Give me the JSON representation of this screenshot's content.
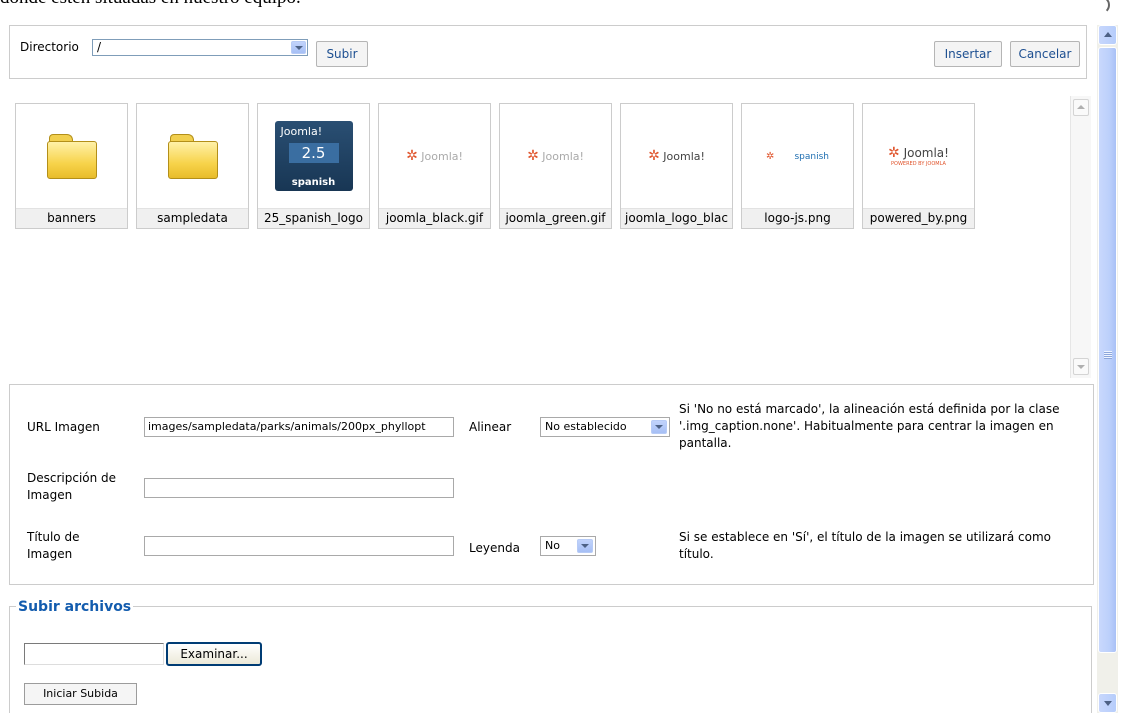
{
  "page": {
    "top_text": "donde estén situadas en nuestro equipo."
  },
  "toolbar": {
    "directory_label": "Directorio",
    "directory_value": "/",
    "up_button": "Subir",
    "insert_button": "Insertar",
    "cancel_button": "Cancelar"
  },
  "browser": {
    "items": [
      {
        "label": "banners",
        "type": "folder"
      },
      {
        "label": "sampledata",
        "type": "folder"
      },
      {
        "label": "25_spanish_logo",
        "type": "image",
        "logo_text": [
          "Joomla!",
          "2.5",
          "spanish"
        ]
      },
      {
        "label": "joomla_black.gif",
        "type": "image",
        "logo_text": "Joomla!"
      },
      {
        "label": "joomla_green.gif",
        "type": "image",
        "logo_text": "Joomla!"
      },
      {
        "label": "joomla_logo_blac",
        "type": "image",
        "logo_text": "Joomla!"
      },
      {
        "label": "logo-js.png",
        "type": "image",
        "logo_text": "spanish"
      },
      {
        "label": "powered_by.png",
        "type": "image",
        "logo_text": [
          "Joomla!",
          "POWERED BY JOOMLA"
        ]
      }
    ]
  },
  "details": {
    "url_label": "URL Imagen",
    "url_value": "images/sampledata/parks/animals/200px_phyllopt",
    "align_label": "Alinear",
    "align_value": "No establecido",
    "align_note": "Si 'No no está marcado', la alineación está definida por la clase '.img_caption.none'. Habitualmente para centrar la imagen en pantalla.",
    "desc_label": "Descripción de Imagen",
    "desc_value": "",
    "title_label": "Título de Imagen",
    "title_value": "",
    "caption_label": "Leyenda",
    "caption_value": "No",
    "caption_note": "Si se establece en 'Sí', el título de la imagen se utilizará como título."
  },
  "upload": {
    "legend": "Subir archivos",
    "browse_button": "Examinar...",
    "start_button": "Iniciar Subida"
  },
  "colors": {
    "legend_blue": "#135cae",
    "button_text_blue": "#1d4f91",
    "border_gray": "#cccccc",
    "scrollbar_blue": "#bcd0fb"
  }
}
